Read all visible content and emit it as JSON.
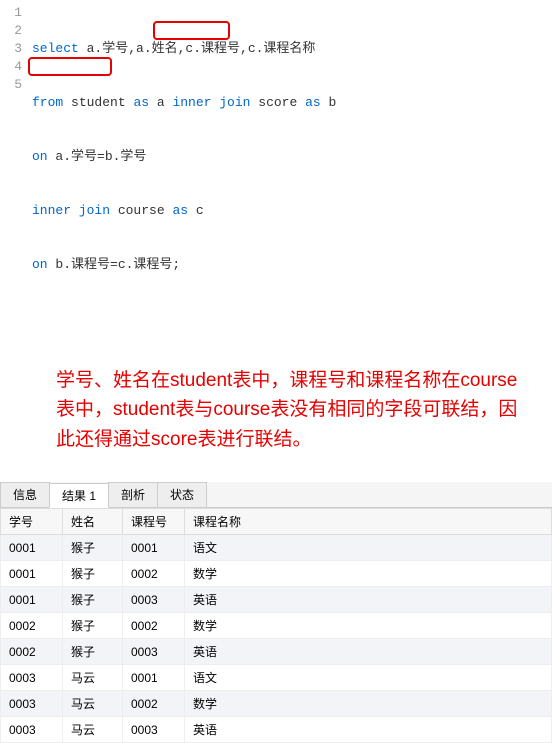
{
  "editor": {
    "lines": [
      "1",
      "2",
      "3",
      "4",
      "5"
    ],
    "code": {
      "l1a": "select",
      "l1b": " a.学号,a.姓名,c.课程号,c.课程名称",
      "l2a": "from",
      "l2b": " student ",
      "l2c": "as",
      "l2d": " a ",
      "l2e": "inner join",
      "l2f": " score ",
      "l2g": "as",
      "l2h": " b",
      "l3a": "on",
      "l3b": " a.学号=b.学号",
      "l4a": "inner join",
      "l4b": " course ",
      "l4c": "as",
      "l4d": " c",
      "l5a": "on",
      "l5b": " b.课程号=c.课程号;"
    }
  },
  "annotation": "学号、姓名在student表中，课程号和课程名称在course表中，student表与course表没有相同的字段可联结，因此还得通过score表进行联结。",
  "tabs": {
    "t0": "信息",
    "t1": "结果 1",
    "t2": "剖析",
    "t3": "状态",
    "active": 1
  },
  "table": {
    "headers": {
      "h0": "学号",
      "h1": "姓名",
      "h2": "课程号",
      "h3": "课程名称"
    },
    "rows": [
      {
        "c0": "0001",
        "c1": "猴子",
        "c2": "0001",
        "c3": "语文"
      },
      {
        "c0": "0001",
        "c1": "猴子",
        "c2": "0002",
        "c3": "数学"
      },
      {
        "c0": "0001",
        "c1": "猴子",
        "c2": "0003",
        "c3": "英语"
      },
      {
        "c0": "0002",
        "c1": "猴子",
        "c2": "0002",
        "c3": "数学"
      },
      {
        "c0": "0002",
        "c1": "猴子",
        "c2": "0003",
        "c3": "英语"
      },
      {
        "c0": "0003",
        "c1": "马云",
        "c2": "0001",
        "c3": "语文"
      },
      {
        "c0": "0003",
        "c1": "马云",
        "c2": "0002",
        "c3": "数学"
      },
      {
        "c0": "0003",
        "c1": "马云",
        "c2": "0003",
        "c3": "英语"
      }
    ]
  }
}
